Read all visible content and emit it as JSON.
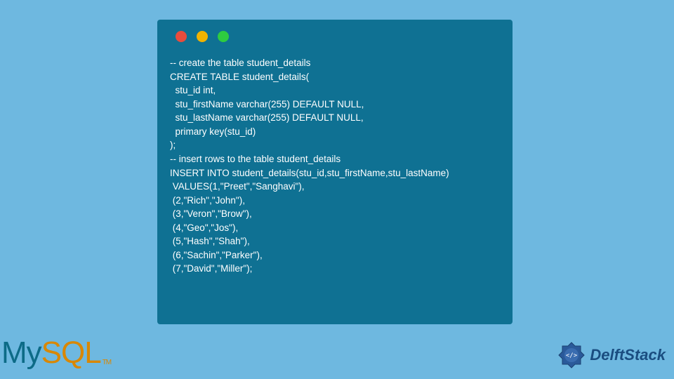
{
  "code": {
    "lines": [
      "-- create the table student_details",
      "CREATE TABLE student_details(",
      "  stu_id int,",
      "  stu_firstName varchar(255) DEFAULT NULL,",
      "  stu_lastName varchar(255) DEFAULT NULL,",
      "  primary key(stu_id)",
      ");",
      "-- insert rows to the table student_details",
      "INSERT INTO student_details(stu_id,stu_firstName,stu_lastName)",
      " VALUES(1,\"Preet\",\"Sanghavi\"),",
      " (2,\"Rich\",\"John\"),",
      " (3,\"Veron\",\"Brow\"),",
      " (4,\"Geo\",\"Jos\"),",
      " (5,\"Hash\",\"Shah\"),",
      " (6,\"Sachin\",\"Parker\"),",
      " (7,\"David\",\"Miller\");"
    ]
  },
  "logos": {
    "mysql_my": "My",
    "mysql_sql": "SQL",
    "mysql_tm": "TM",
    "delftstack": "DelftStack"
  }
}
